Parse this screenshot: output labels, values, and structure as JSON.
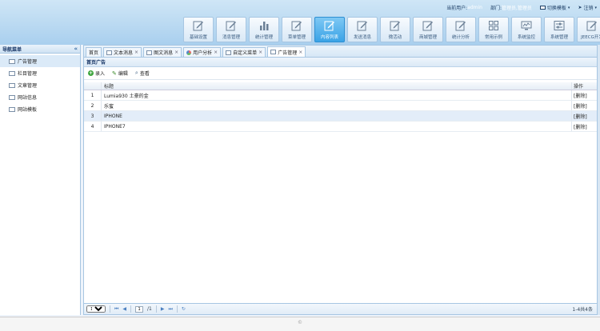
{
  "header": {
    "greeting_prefix": "当前用户:",
    "username": "admin",
    "role_prefix": "部门:",
    "role": "管理员,管理员",
    "switch_label": "切换模板",
    "logout_label": "注销"
  },
  "toolbar": [
    {
      "label": "基础设置",
      "icon": "edit"
    },
    {
      "label": "消息管理",
      "icon": "edit"
    },
    {
      "label": "统计管理",
      "icon": "bar"
    },
    {
      "label": "菜单管理",
      "icon": "edit"
    },
    {
      "label": "内容列表",
      "icon": "edit"
    },
    {
      "label": "发送消息",
      "icon": "edit"
    },
    {
      "label": "微活动",
      "icon": "edit"
    },
    {
      "label": "商城管理",
      "icon": "edit"
    },
    {
      "label": "统计分析",
      "icon": "edit"
    },
    {
      "label": "常用示例",
      "icon": "grid"
    },
    {
      "label": "系统监控",
      "icon": "monitor"
    },
    {
      "label": "系统管理",
      "icon": "sliders"
    },
    {
      "label": "JEECG开发",
      "icon": "edit"
    }
  ],
  "sidebar": {
    "title": "导航菜单",
    "collapse_glyph": "«",
    "items": [
      {
        "label": "广告管理"
      },
      {
        "label": "栏目管理"
      },
      {
        "label": "文章管理"
      },
      {
        "label": "网站信息"
      },
      {
        "label": "网站模板"
      }
    ]
  },
  "tabs": [
    {
      "label": "首页",
      "icon": "none",
      "closable": false
    },
    {
      "label": "文本消息",
      "icon": "box",
      "closable": true
    },
    {
      "label": "图文消息",
      "icon": "box",
      "closable": true
    },
    {
      "label": "用户分析",
      "icon": "pie",
      "closable": true
    },
    {
      "label": "自定义菜单",
      "icon": "box",
      "closable": true
    },
    {
      "label": "广告管理",
      "icon": "box",
      "closable": true
    }
  ],
  "panel": {
    "title": "首页广告",
    "actions": {
      "add": "录入",
      "edit": "编辑",
      "view": "查看"
    }
  },
  "grid": {
    "columns": {
      "title": "标题",
      "op": "操作"
    },
    "rows": [
      {
        "num": "1",
        "title": "Lumia930 土豪的金",
        "op": "[删除]"
      },
      {
        "num": "2",
        "title": "乐蜜",
        "op": "[删除]"
      },
      {
        "num": "3",
        "title": "IPHONE",
        "op": "[删除]"
      },
      {
        "num": "4",
        "title": "IPHONE7",
        "op": "[删除]"
      }
    ],
    "selected_row": 2
  },
  "pager": {
    "page_size": "10",
    "page": "1",
    "page_total": "/1",
    "summary": "1-4共4条"
  },
  "footer": {
    "text": "©"
  }
}
